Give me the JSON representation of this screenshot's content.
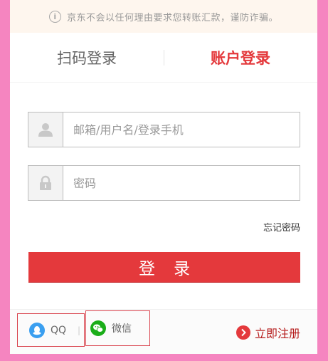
{
  "notice": {
    "icon": "info-icon",
    "icon_glyph": "i",
    "text": "京东不会以任何理由要求您转账汇款，谨防诈骗。"
  },
  "tabs": [
    {
      "label": "扫码登录",
      "active": false
    },
    {
      "label": "账户登录",
      "active": true
    }
  ],
  "form": {
    "username_placeholder": "邮箱/用户名/登录手机",
    "username_value": "",
    "password_placeholder": "密码",
    "password_value": "",
    "forgot_label": "忘记密码",
    "login_label": "登录"
  },
  "oauth": {
    "qq_label": "QQ",
    "separator": "|",
    "wechat_label": "微信"
  },
  "register": {
    "label": "立即注册"
  },
  "colors": {
    "accent": "#e4393c",
    "background": "#f585c0",
    "notice_bg": "#fef6ee",
    "qq_blue": "#3a9ff0",
    "wechat_green": "#1aad19",
    "register_red": "#b61d1d"
  }
}
